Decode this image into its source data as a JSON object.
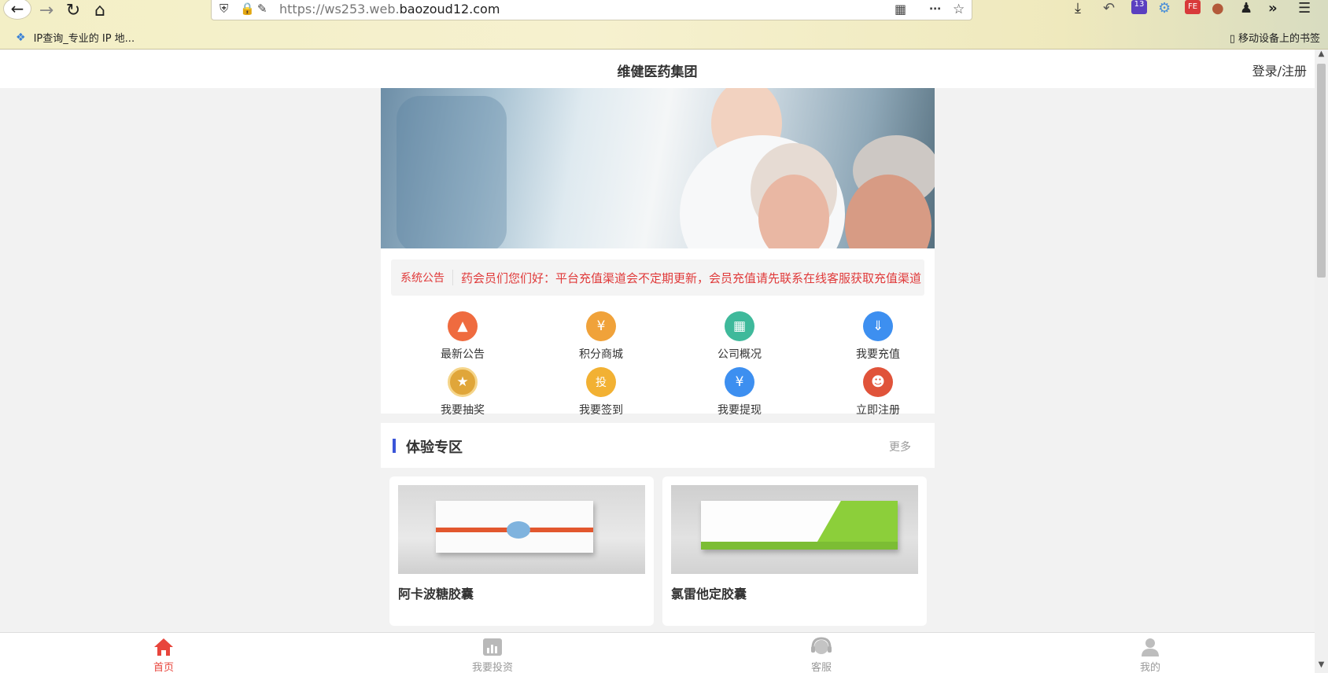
{
  "browser": {
    "url_prefix": "https://ws253.web.",
    "url_domain": "baozoud12.com",
    "bookmark_label": "IP查询_专业的 IP 地...",
    "mobile_bookmarks": "移动设备上的书签",
    "badge_count": "13"
  },
  "header": {
    "title": "维健医药集团",
    "login": "登录/注册"
  },
  "notice": {
    "tag": "系统公告",
    "text": "药会员们您们好：平台充值渠道会不定期更新，会员充值请先联系在线客服获取充值渠道"
  },
  "menu": [
    {
      "label": "最新公告",
      "icon": "megaphone-icon",
      "color": "#ef6b3f"
    },
    {
      "label": "积分商城",
      "icon": "yen-ticket-icon",
      "color": "#f0a23a"
    },
    {
      "label": "公司概况",
      "icon": "building-icon",
      "color": "#3fb99b"
    },
    {
      "label": "我要充值",
      "icon": "deposit-icon",
      "color": "#3d8ff0"
    },
    {
      "label": "我要抽奖",
      "icon": "medal-icon",
      "color": "#e0a63a"
    },
    {
      "label": "我要签到",
      "icon": "checkin-icon",
      "color": "#f2b133"
    },
    {
      "label": "我要提现",
      "icon": "withdraw-icon",
      "color": "#3d8ff0"
    },
    {
      "label": "立即注册",
      "icon": "register-icon",
      "color": "#e0533a"
    }
  ],
  "section": {
    "title": "体验专区",
    "more": "更多"
  },
  "products": [
    {
      "name": "阿卡波糖胶囊"
    },
    {
      "name": "氯雷他定胶囊"
    }
  ],
  "tabs": [
    {
      "label": "首页",
      "active": true
    },
    {
      "label": "我要投资",
      "active": false
    },
    {
      "label": "客服",
      "active": false
    },
    {
      "label": "我的",
      "active": false
    }
  ]
}
